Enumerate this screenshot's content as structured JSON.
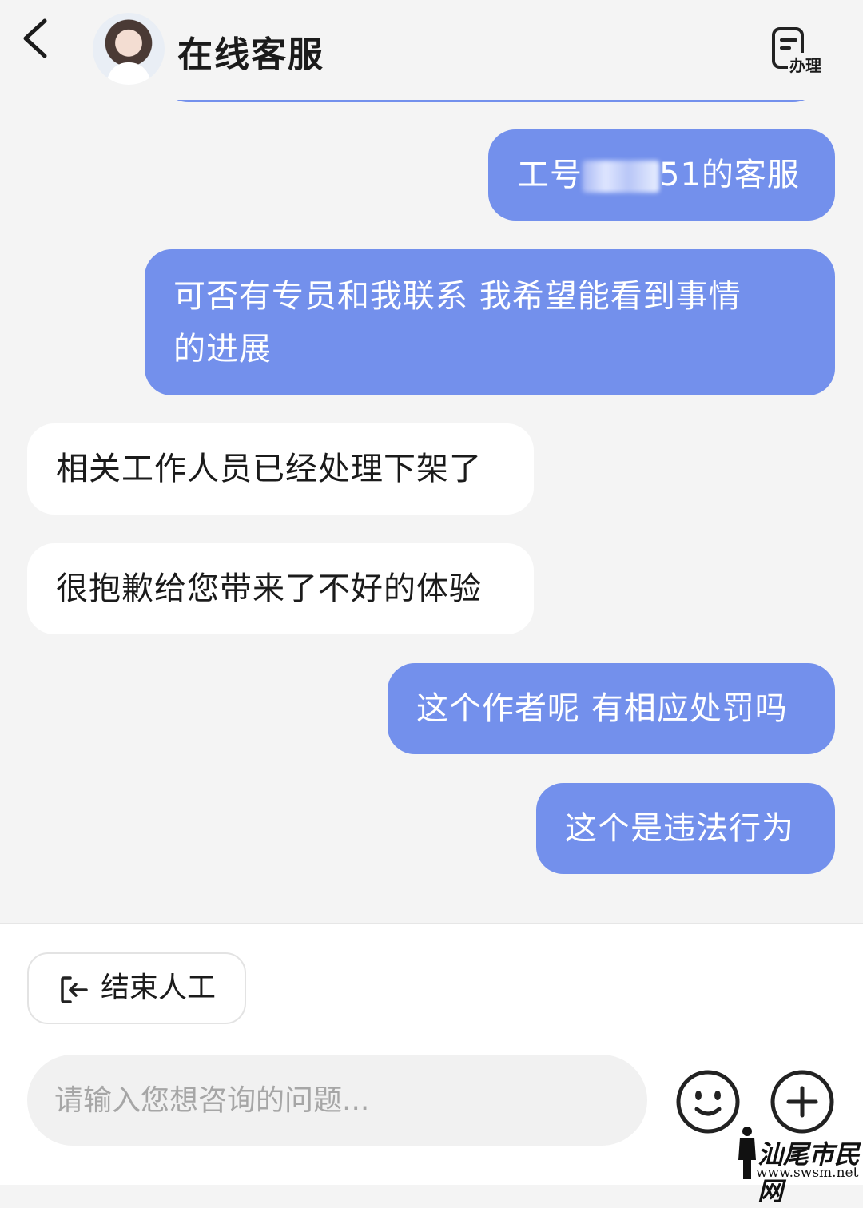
{
  "header": {
    "title": "在线客服",
    "handle_label": "办理"
  },
  "messages": [
    {
      "from": "me",
      "parts": [
        "工号",
        "",
        "51的客服"
      ]
    },
    {
      "from": "me",
      "lines": [
        "可否有专员和我联系 我希望能看到事情",
        "的进展"
      ]
    },
    {
      "from": "agent",
      "text": "相关工作人员已经处理下架了"
    },
    {
      "from": "agent",
      "text": "很抱歉给您带来了不好的体验"
    },
    {
      "from": "me",
      "text": "这个作者呢 有相应处罚吗"
    },
    {
      "from": "me",
      "text": "这个是违法行为"
    }
  ],
  "footer": {
    "end_label": "结束人工",
    "input_placeholder": "请输入您想咨询的问题..."
  },
  "watermark": {
    "text": "汕尾市民网",
    "url": "www.swsm.net"
  },
  "colors": {
    "my_bubble": "#7390ec",
    "agent_bubble": "#ffffff",
    "background": "#f4f4f4"
  },
  "icons": [
    "back-arrow-icon",
    "agent-avatar",
    "handle-form-icon",
    "exit-icon",
    "emoji-icon",
    "plus-icon"
  ]
}
